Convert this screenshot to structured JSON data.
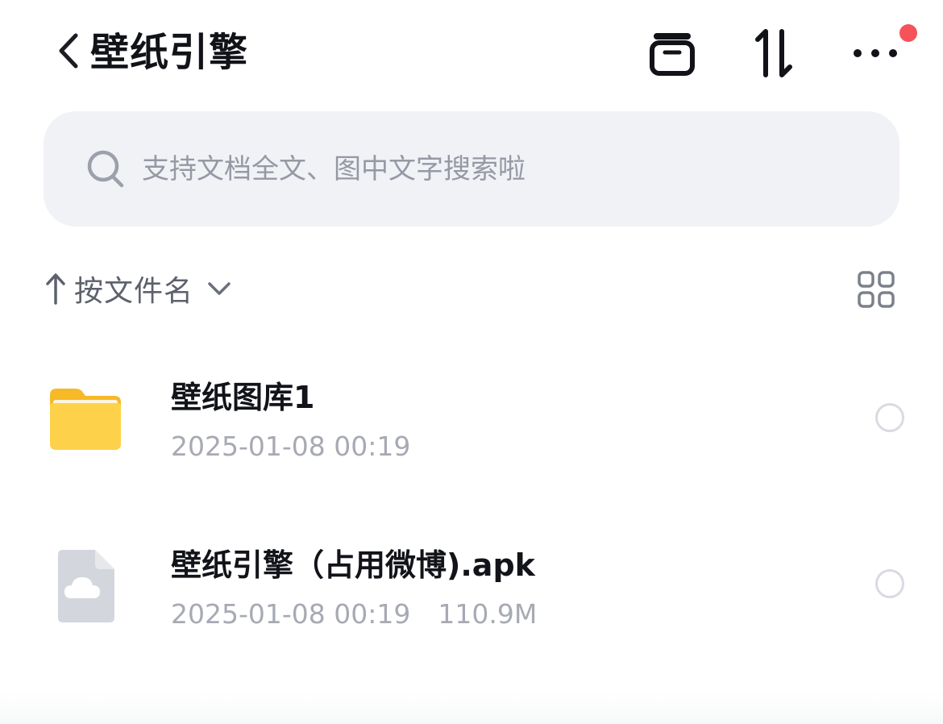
{
  "header": {
    "title": "壁纸引擎",
    "back_icon": "chevron-left-icon",
    "actions": [
      {
        "name": "archive-icon"
      },
      {
        "name": "sort-icon"
      },
      {
        "name": "more-icon"
      }
    ],
    "notification_dot_color": "#f5525a"
  },
  "search": {
    "placeholder": "支持文档全文、图中文字搜索啦",
    "icon": "search-icon"
  },
  "sort": {
    "direction_icon": "arrow-up-icon",
    "label": "按文件名",
    "dropdown_icon": "chevron-down-icon",
    "view_icon": "grid-view-icon"
  },
  "files": [
    {
      "name": "壁纸图库1",
      "type": "folder",
      "icon": "folder-icon",
      "date": "2025-01-08 00:19",
      "size": ""
    },
    {
      "name": "壁纸引擎（占用微博).apk",
      "type": "file",
      "icon": "cloud-file-icon",
      "date": "2025-01-08 00:19",
      "size": "110.9M"
    }
  ],
  "colors": {
    "folder": "#fcc83a",
    "search_bg": "#f1f2f6",
    "meta_text": "#a7aab3"
  }
}
